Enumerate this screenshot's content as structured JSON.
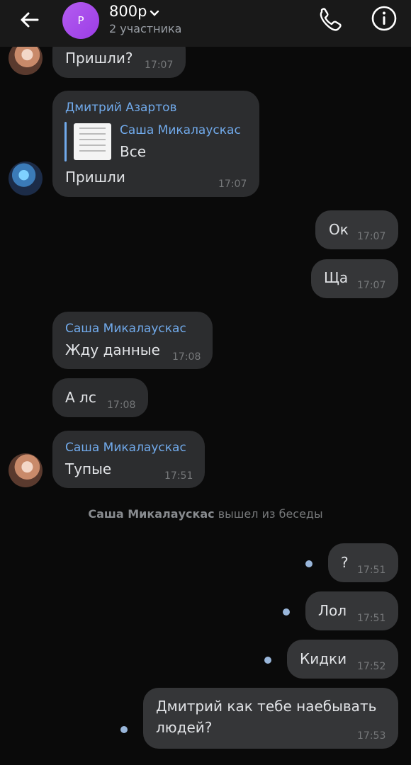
{
  "header": {
    "avatar_letter": "Р",
    "title": "800р",
    "subtitle": "2 участника"
  },
  "messages": [
    {
      "text": "Пришли?",
      "time": "17:07"
    },
    {
      "sender": "Дмитрий Азартов",
      "reply_name": "Саша Микалаускас",
      "reply_text": "Все",
      "text": "Пришли",
      "time": "17:07"
    },
    {
      "text": "Ок",
      "time": "17:07"
    },
    {
      "text": "Ща",
      "time": "17:07"
    },
    {
      "sender": "Саша Микалаускас",
      "text": "Жду данные",
      "time": "17:08"
    },
    {
      "text": "А лс",
      "time": "17:08"
    },
    {
      "sender": "Саша Микалаускас",
      "text": "Тупые",
      "time": "17:51"
    },
    {
      "text": "?",
      "time": "17:51"
    },
    {
      "text": "Лол",
      "time": "17:51"
    },
    {
      "text": "Кидки",
      "time": "17:52"
    },
    {
      "text": "Дмитрий как тебе наебывать",
      "text2": "людей?",
      "time": "17:53"
    }
  ],
  "service": {
    "name": "Саша Микалаускас",
    "text": "вышел из беседы"
  },
  "colors": {
    "accent": "#71aaeb",
    "bubble_in": "#2c2d2f",
    "bubble_out": "#353638",
    "unread_dot": "#99b6da"
  }
}
